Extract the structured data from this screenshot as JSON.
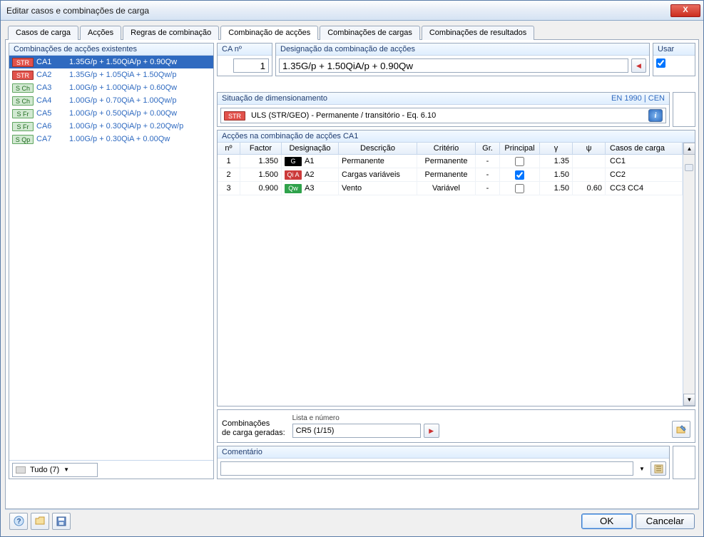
{
  "window": {
    "title": "Editar casos e combinações de carga"
  },
  "tabs": [
    "Casos de carga",
    "Acções",
    "Regras de combinação",
    "Combinação de acções",
    "Combinações de cargas",
    "Combinações de resultados"
  ],
  "activeTab": 3,
  "leftPanel": {
    "header": "Combinações de acções existentes",
    "rows": [
      {
        "badge": "STR",
        "bclass": "b-str",
        "name": "CA1",
        "formula": "1.35G/p + 1.50QiA/p + 0.90Qw",
        "sel": true
      },
      {
        "badge": "STR",
        "bclass": "b-str",
        "name": "CA2",
        "formula": "1.35G/p + 1.05QiA + 1.50Qw/p"
      },
      {
        "badge": "S Ch",
        "bclass": "b-sch",
        "name": "CA3",
        "formula": "1.00G/p + 1.00QiA/p + 0.60Qw"
      },
      {
        "badge": "S Ch",
        "bclass": "b-sch",
        "name": "CA4",
        "formula": "1.00G/p + 0.70QiA + 1.00Qw/p"
      },
      {
        "badge": "S Fr",
        "bclass": "b-sfr",
        "name": "CA5",
        "formula": "1.00G/p + 0.50QiA/p + 0.00Qw"
      },
      {
        "badge": "S Fr",
        "bclass": "b-sfr",
        "name": "CA6",
        "formula": "1.00G/p + 0.30QiA/p + 0.20Qw/p"
      },
      {
        "badge": "S Qp",
        "bclass": "b-sqp",
        "name": "CA7",
        "formula": "1.00G/p + 0.30QiA + 0.00Qw"
      }
    ],
    "filter": "Tudo (7)"
  },
  "caNo": {
    "label": "CA nº",
    "value": "1"
  },
  "designation": {
    "label": "Designação da combinação de acções",
    "value": "1.35G/p + 1.50QiA/p + 0.90Qw"
  },
  "use": {
    "label": "Usar",
    "checked": true
  },
  "situation": {
    "label": "Situação de dimensionamento",
    "norm": "EN 1990 | CEN",
    "badge": "STR",
    "text": "ULS (STR/GEO) - Permanente / transitório - Eq. 6.10"
  },
  "actions": {
    "header": "Acções na combinação de acções CA1",
    "cols": [
      "nº",
      "Factor",
      "Designação",
      "Descrição",
      "Critério",
      "Gr.",
      "Principal",
      "γ",
      "ψ",
      "Casos de carga"
    ],
    "rows": [
      {
        "n": "1",
        "factor": "1.350",
        "dBadge": "G",
        "dBadgeClass": "db-g",
        "dName": "A1",
        "desc": "Permanente",
        "crit": "Permanente",
        "gr": "-",
        "principal": false,
        "gamma": "1.35",
        "psi": "",
        "cc": "CC1"
      },
      {
        "n": "2",
        "factor": "1.500",
        "dBadge": "Qi A",
        "dBadgeClass": "db-qia",
        "dName": "A2",
        "desc": "Cargas variáveis",
        "crit": "Permanente",
        "gr": "-",
        "principal": true,
        "gamma": "1.50",
        "psi": "",
        "cc": "CC2"
      },
      {
        "n": "3",
        "factor": "0.900",
        "dBadge": "Qw",
        "dBadgeClass": "db-qw",
        "dName": "A3",
        "desc": "Vento",
        "crit": "Variável",
        "gr": "-",
        "principal": false,
        "gamma": "1.50",
        "psi": "0.60",
        "cc": "CC3  CC4"
      }
    ]
  },
  "generated": {
    "label1": "Combinações",
    "label2": "de carga geradas:",
    "sub": "Lista e número",
    "value": "CR5 (1/15)"
  },
  "comment": {
    "label": "Comentário",
    "value": ""
  },
  "buttons": {
    "ok": "OK",
    "cancel": "Cancelar"
  }
}
